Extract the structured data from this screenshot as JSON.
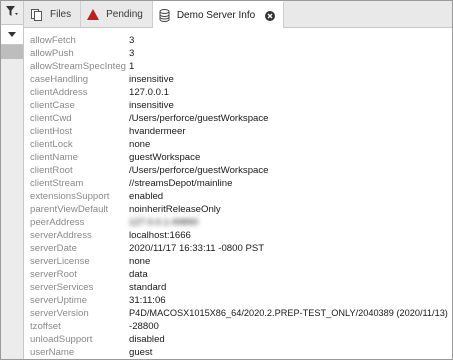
{
  "tabs": [
    {
      "label": "Files",
      "icon": "files-icon"
    },
    {
      "label": "Pending",
      "icon": "pending-warning-icon"
    },
    {
      "label": "Demo Server Info",
      "icon": "database-icon",
      "active": true
    }
  ],
  "server_info": [
    {
      "key": "allowFetch",
      "value": "3"
    },
    {
      "key": "allowPush",
      "value": "3"
    },
    {
      "key": "allowStreamSpecInteg",
      "value": "1"
    },
    {
      "key": "caseHandling",
      "value": "insensitive"
    },
    {
      "key": "clientAddress",
      "value": "127.0.0.1"
    },
    {
      "key": "clientCase",
      "value": "insensitive"
    },
    {
      "key": "clientCwd",
      "value": "/Users/perforce/guestWorkspace"
    },
    {
      "key": "clientHost",
      "value": "hvandermeer"
    },
    {
      "key": "clientLock",
      "value": "none"
    },
    {
      "key": "clientName",
      "value": "guestWorkspace"
    },
    {
      "key": "clientRoot",
      "value": "/Users/perforce/guestWorkspace"
    },
    {
      "key": "clientStream",
      "value": "//streamsDepot/mainline"
    },
    {
      "key": "extensionsSupport",
      "value": "enabled"
    },
    {
      "key": "parentViewDefault",
      "value": "noinheritReleaseOnly"
    },
    {
      "key": "peerAddress",
      "value": "127.0.0.1:49890"
    },
    {
      "key": "serverAddress",
      "value": "localhost:1666"
    },
    {
      "key": "serverDate",
      "value": "2020/11/17 16:33:11 -0800 PST"
    },
    {
      "key": "serverLicense",
      "value": "none"
    },
    {
      "key": "serverRoot",
      "value": "data"
    },
    {
      "key": "serverServices",
      "value": "standard"
    },
    {
      "key": "serverUptime",
      "value": "31:11:06"
    },
    {
      "key": "serverVersion",
      "value": "P4D/MACOSX1015X86_64/2020.2.PREP-TEST_ONLY/2040389 (2020/11/13)"
    },
    {
      "key": "tzoffset",
      "value": "-28800"
    },
    {
      "key": "unloadSupport",
      "value": "disabled"
    },
    {
      "key": "userName",
      "value": "guest"
    }
  ],
  "colors": {
    "pending_icon": "#c0201a",
    "tab_bar_bg": "#e9e9e9",
    "key_text": "#8a8a8a"
  }
}
